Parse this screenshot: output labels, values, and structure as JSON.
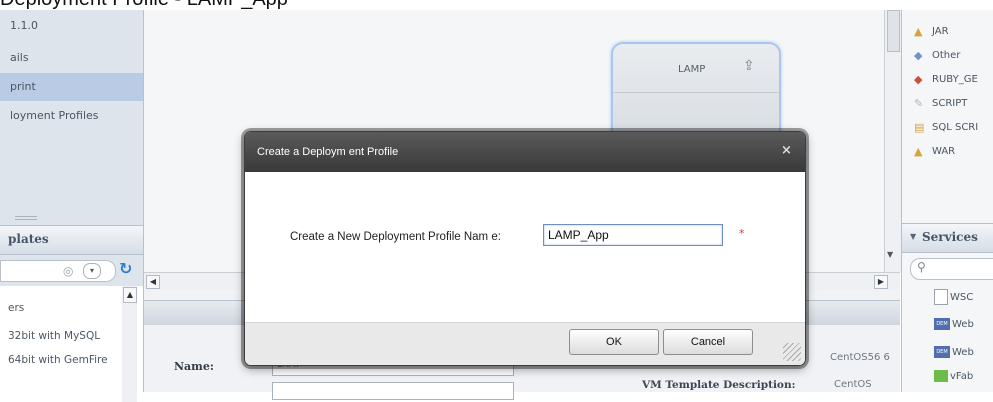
{
  "window": {
    "title": "Deployment Profile - LAMP_App"
  },
  "left_nav": {
    "items": [
      {
        "label": "1.1.0",
        "selected": false
      },
      {
        "label": "ails",
        "selected": false
      },
      {
        "label": "print",
        "selected": true
      },
      {
        "label": "loyment Profiles",
        "selected": false
      }
    ]
  },
  "templates": {
    "header": "plates",
    "list": [
      {
        "label": "ers"
      },
      {
        "label": "32bit with MySQL"
      },
      {
        "label": "64bit with GemFire"
      }
    ]
  },
  "canvas": {
    "component_label": "LAMP"
  },
  "properties": {
    "name_label": "Name:",
    "name_value": "LAMP",
    "right_value_1": "CentOS56 6",
    "vm_desc_label": "VM Template Description:",
    "vm_desc_value": "CentOS"
  },
  "right_panel": {
    "items": [
      {
        "icon": "jar-icon",
        "glyph": "▲",
        "label": "JAR",
        "color": "#d9a13b"
      },
      {
        "icon": "other-icon",
        "glyph": "◆",
        "label": "Other",
        "color": "#6f93c9"
      },
      {
        "icon": "ruby-icon",
        "glyph": "◆",
        "label": "RUBY_GE",
        "color": "#c8503b"
      },
      {
        "icon": "script-icon",
        "glyph": "✎",
        "label": "SCRIPT",
        "color": "#b0b6be"
      },
      {
        "icon": "sql-script-icon",
        "glyph": "▤",
        "label": "SQL SCRI",
        "color": "#d9a13b"
      },
      {
        "icon": "war-icon",
        "glyph": "▲",
        "label": "WAR",
        "color": "#d9a13b"
      }
    ],
    "services_header": "Services",
    "services": [
      {
        "label": "WSC",
        "kind": "doc"
      },
      {
        "label": "Web",
        "kind": "badge"
      },
      {
        "label": "Web",
        "kind": "badge"
      },
      {
        "label": "vFab",
        "kind": "green"
      }
    ]
  },
  "dialog": {
    "title": "Create a Deploym ent Profile",
    "close_glyph": "×",
    "field_label": "Create a New Deployment Profile Nam e:",
    "field_value": "LAMP_App",
    "required_mark": "*",
    "ok_label": "OK",
    "cancel_label": "Cancel"
  },
  "colors": {
    "selected_nav": "#b9cbe5",
    "dialog_title_bar": "#393939",
    "required": "#e4332b",
    "input_focus_border": "#6d8fc1"
  }
}
